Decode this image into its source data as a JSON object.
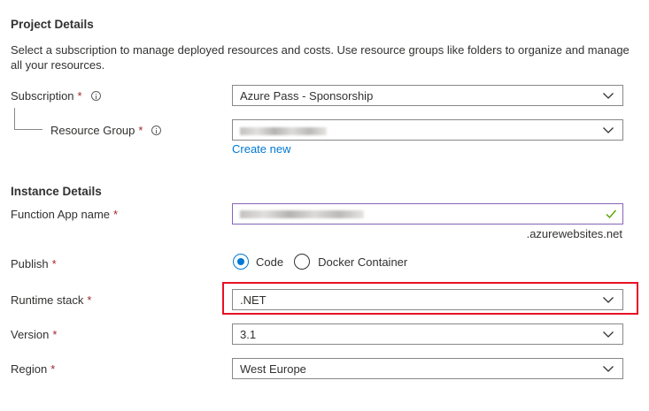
{
  "project_details": {
    "title": "Project Details",
    "description": "Select a subscription to manage deployed resources and costs. Use resource groups like folders to organize and manage all your resources.",
    "subscription": {
      "label": "Subscription",
      "required_mark": "*",
      "value": "Azure Pass - Sponsorship"
    },
    "resource_group": {
      "label": "Resource Group",
      "required_mark": "*",
      "create_new_link": "Create new"
    }
  },
  "instance_details": {
    "title": "Instance Details",
    "function_app_name": {
      "label": "Function App name",
      "required_mark": "*",
      "suffix": ".azurewebsites.net"
    },
    "publish": {
      "label": "Publish",
      "required_mark": "*",
      "options": [
        {
          "label": "Code",
          "selected": true
        },
        {
          "label": "Docker Container",
          "selected": false
        }
      ]
    },
    "runtime_stack": {
      "label": "Runtime stack",
      "required_mark": "*",
      "value": ".NET"
    },
    "version": {
      "label": "Version",
      "required_mark": "*",
      "value": "3.1"
    },
    "region": {
      "label": "Region",
      "required_mark": "*",
      "value": "West Europe"
    }
  },
  "colors": {
    "accent": "#0078d4",
    "required": "#a4262c",
    "valid_check": "#57a300",
    "highlight": "#e81123",
    "focus_border": "#8764b8"
  }
}
